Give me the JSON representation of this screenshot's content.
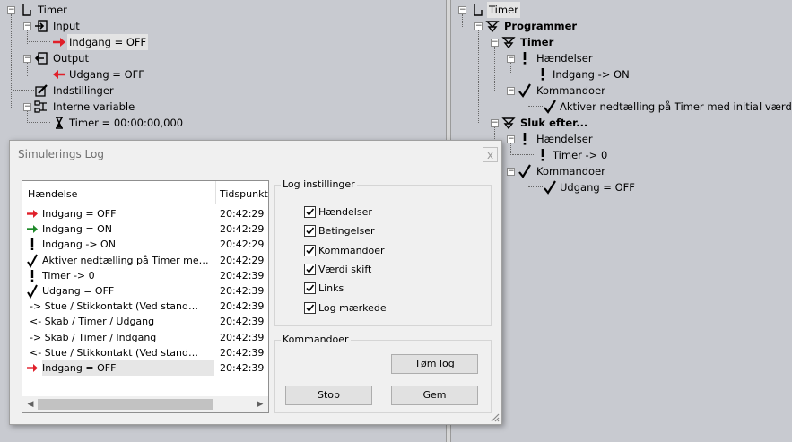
{
  "left_tree": {
    "root": "Timer",
    "input_label": "Input",
    "input_value": "Indgang = OFF",
    "output_label": "Output",
    "output_value": "Udgang = OFF",
    "settings_label": "Indstillinger",
    "internal_label": "Interne variable",
    "internal_value": "Timer = 00:00:00,000"
  },
  "right_tree": {
    "root": "Timer",
    "programmer": "Programmer",
    "prog1": "Timer",
    "events1": "Hændelser",
    "event1_value": "Indgang -> ON",
    "commands1": "Kommandoer",
    "command1_value": "Aktiver nedtælling på Timer med initial værdi",
    "prog2": "Sluk efter...",
    "events2": "Hændelser",
    "event2_value": "Timer -> 0",
    "commands2": "Kommandoer",
    "command2_value": "Udgang = OFF"
  },
  "dialog": {
    "title": "Simulerings Log",
    "close_glyph": "x",
    "columns": {
      "event": "Hændelse",
      "time": "Tidspunkt"
    },
    "rows": [
      {
        "icon": "red-arrow-right",
        "text": "Indgang = OFF",
        "time": "20:42:29"
      },
      {
        "icon": "green-arrow-right",
        "text": "Indgang = ON",
        "time": "20:42:29"
      },
      {
        "icon": "exclamation",
        "text": "Indgang -> ON",
        "time": "20:42:29"
      },
      {
        "icon": "checkmark",
        "text": "Aktiver nedtælling på Timer med initial ...",
        "time": "20:42:29"
      },
      {
        "icon": "exclamation",
        "text": "Timer -> 0",
        "time": "20:42:39"
      },
      {
        "icon": "checkmark",
        "text": "Udgang = OFF",
        "time": "20:42:39"
      },
      {
        "icon": "none",
        "text": "-> Stue / Stikkontakt (Ved standerlampe...",
        "time": "20:42:39"
      },
      {
        "icon": "none",
        "text": "<- Skab / Timer / Udgang",
        "time": "20:42:39"
      },
      {
        "icon": "none",
        "text": "-> Skab / Timer / Indgang",
        "time": "20:42:39"
      },
      {
        "icon": "none",
        "text": "<- Stue / Stikkontakt (Ved standerlampe...",
        "time": "20:42:39"
      },
      {
        "icon": "red-arrow-right",
        "text": "Indgang = OFF",
        "time": "20:42:39"
      }
    ],
    "log_settings": {
      "title": "Log instillinger",
      "options": [
        {
          "label": "Hændelser",
          "checked": true
        },
        {
          "label": "Betingelser",
          "checked": true
        },
        {
          "label": "Kommandoer",
          "checked": true
        },
        {
          "label": "Værdi skift",
          "checked": true
        },
        {
          "label": "Links",
          "checked": true
        },
        {
          "label": "Log mærkede",
          "checked": true
        }
      ]
    },
    "commands": {
      "title": "Kommandoer",
      "clear_label": "Tøm log",
      "stop_label": "Stop",
      "save_label": "Gem"
    }
  },
  "colors": {
    "red_arrow": "#e0202a",
    "green_arrow": "#1f8a2a",
    "background": "#c8cad0"
  }
}
